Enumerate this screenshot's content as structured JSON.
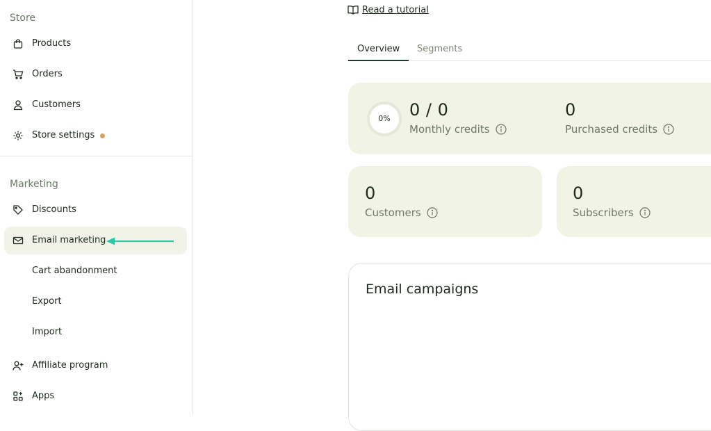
{
  "sidebar": {
    "store_title": "Store",
    "marketing_title": "Marketing",
    "items": [
      {
        "label": "Products"
      },
      {
        "label": "Orders"
      },
      {
        "label": "Customers"
      },
      {
        "label": "Store settings"
      },
      {
        "label": "Discounts"
      },
      {
        "label": "Email marketing"
      },
      {
        "label": "Cart abandonment"
      },
      {
        "label": "Export"
      },
      {
        "label": "Import"
      },
      {
        "label": "Affiliate program"
      },
      {
        "label": "Apps"
      }
    ],
    "settings_dot_color": "#d4a25e",
    "active_bg_color": "#f1f3e8",
    "arrow_color": "#2ac8a4"
  },
  "main": {
    "tutorial_label": "Read a tutorial",
    "tabs": [
      {
        "label": "Overview"
      },
      {
        "label": "Segments"
      }
    ],
    "credits": {
      "percent": "0%",
      "monthly_value": "0 / 0",
      "monthly_label": "Monthly credits",
      "purchased_value": "0",
      "purchased_label": "Purchased credits"
    },
    "customers": {
      "value": "0",
      "label": "Customers"
    },
    "subscribers": {
      "value": "0",
      "label": "Subscribers"
    },
    "campaigns_title": "Email campaigns"
  }
}
